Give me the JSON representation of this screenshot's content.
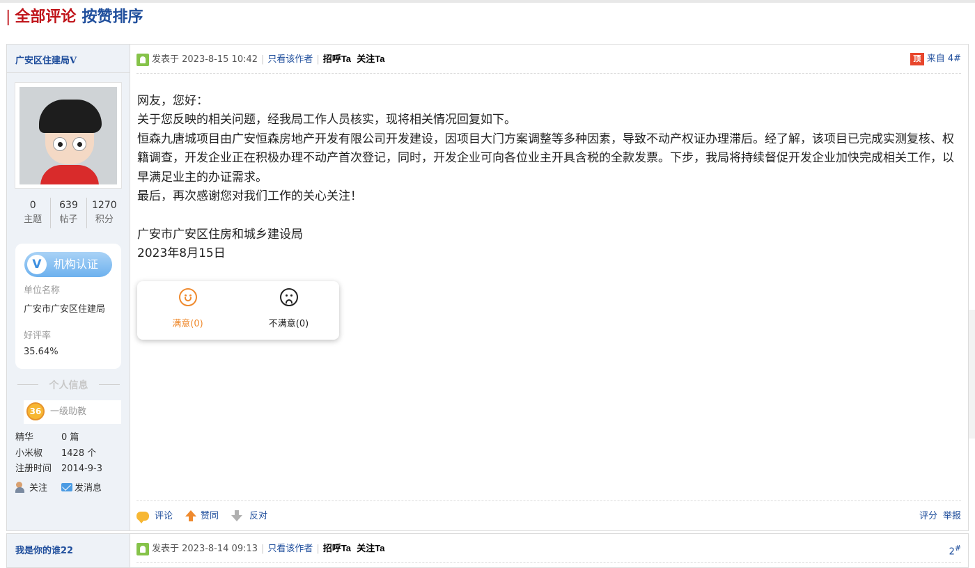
{
  "section": {
    "bar": "|",
    "all_comments": "全部评论",
    "sort_by_likes": "按赞排序"
  },
  "posts": [
    {
      "user": {
        "name": "广安区住建局",
        "verified_mark": "V",
        "stats": [
          {
            "num": "0",
            "label": "主题"
          },
          {
            "num": "639",
            "label": "帖子"
          },
          {
            "num": "1270",
            "label": "积分"
          }
        ],
        "cert": {
          "badge": "机构认证",
          "unit_label": "单位名称",
          "unit_value": "广安市广安区住建局",
          "rating_label": "好评率",
          "rating_value": "35.64%"
        },
        "personal_info_title": "个人信息",
        "level_num": "36",
        "level_name": "一级助教",
        "info": [
          {
            "k": "精华",
            "v": "0 篇"
          },
          {
            "k": "小米椒",
            "v": "1428 个"
          },
          {
            "k": "注册时间",
            "v": "2014-9-3"
          }
        ],
        "follow": "关注",
        "message": "发消息"
      },
      "header": {
        "posted": "发表于 2023-8-15 10:42",
        "sep": "|",
        "only_author": "只看该作者",
        "greet": "招呼Ta",
        "follow": "关注Ta",
        "top_icon": "顶",
        "floor": "来自 4#"
      },
      "content": [
        "网友，您好：",
        "关于您反映的相关问题，经我局工作人员核实，现将相关情况回复如下。",
        "恒森九唐城项目由广安恒森房地产开发有限公司开发建设，因项目大门方案调整等多种因素，导致不动产权证办理滞后。经了解，该项目已完成实测复核、权籍调查，开发企业正在积极办理不动产首次登记，同时，开发企业可向各位业主开具含税的全款发票。下步，我局将持续督促开发企业加快完成相关工作，以早满足业主的办证需求。",
        "最后，再次感谢您对我们工作的关心关注！",
        "",
        "广安市广安区住房和城乡建设局",
        "2023年8月15日"
      ],
      "rating": {
        "satisfied": "满意(0)",
        "unsatisfied": "不满意(0)"
      },
      "footer": {
        "comment": "评论",
        "agree": "赞同",
        "oppose": "反对",
        "score": "评分",
        "report": "举报"
      }
    },
    {
      "user": {
        "name": "我是你的谁22"
      },
      "header": {
        "posted": "发表于 2023-8-14 09:13",
        "sep": "|",
        "only_author": "只看该作者",
        "greet": "招呼Ta",
        "follow": "关注Ta",
        "floor": "2",
        "floor_sup": "#"
      }
    }
  ],
  "colors": {
    "title_red": "#c0141a",
    "link_blue": "#1f4e9c",
    "sidebar_bg": "#eef2f7",
    "accent_orange": "#ef8a2e"
  }
}
